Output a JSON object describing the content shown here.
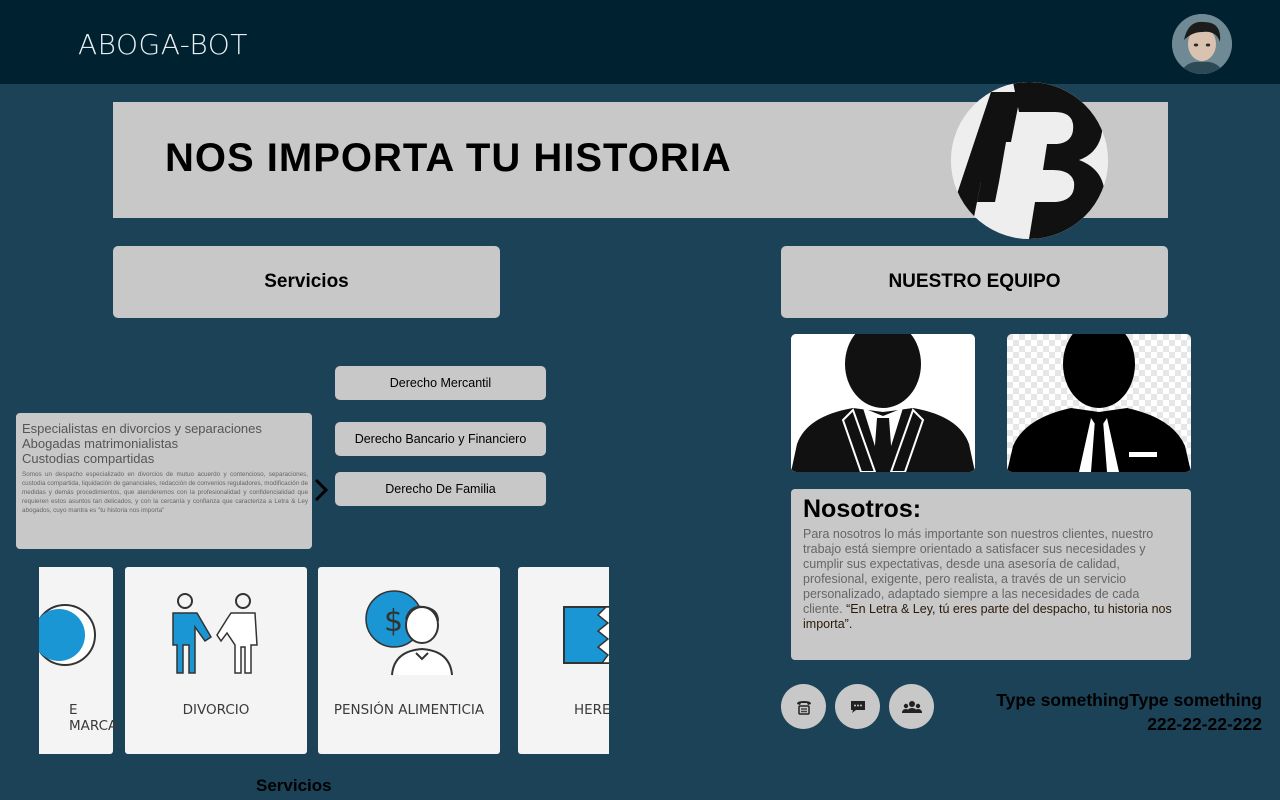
{
  "header": {
    "brand": "ABOGA-BOT",
    "avatar_icon": "user-avatar"
  },
  "hero": {
    "title": "NOS IMPORTA TU HISTORIA",
    "logo_icon": "ab-logo"
  },
  "services": {
    "heading": "Servicios",
    "buttons": [
      "Derecho Mercantil",
      "Derecho Bancario y Financiero",
      "Derecho De Familia"
    ],
    "info": {
      "lines": [
        "Especialistas en divorcios y separaciones",
        "Abogadas matrimonialistas",
        "Custodias compartidas"
      ],
      "paragraph": "Somos un despacho especializado en divorcios de mutuo acuerdo y contencioso, separaciones, custodia compartida, liquidación de gananciales, redacción de convenios reguladores, modificación de medidas y demás procedimientos, que atenderemos con la profesionalidad y confidencialidad que requieren estos asuntos tan delicados, y con la cercanía y confianza que caracteriza a Letra & Ley abogados, cuyo mantra es \"tu historia nos importa\""
    },
    "carousel": [
      {
        "label": "E MARCA",
        "icon": "trademark-icon"
      },
      {
        "label": "DIVORCIO",
        "icon": "divorce-icon"
      },
      {
        "label": "PENSIÓN ALIMENTICIA",
        "icon": "alimony-icon"
      },
      {
        "label": "HERE",
        "icon": "inheritance-icon"
      }
    ],
    "footer_label": "Servicios"
  },
  "team": {
    "heading": "NUESTRO EQUIPO",
    "members": [
      {
        "icon": "person-silhouette-icon"
      },
      {
        "icon": "person-silhouette-icon"
      }
    ]
  },
  "about": {
    "title": "Nosotros:",
    "body": "Para nosotros lo más importante son nuestros clientes, nuestro trabajo está siempre orientado a satisfacer sus necesidades y cumplir sus expectativas, desde una asesoría de calidad, profesional, exigente, pero realista, a través de un servicio personalizado, adaptado siempre a las necesidades de cada cliente. ",
    "quote": "“En Letra & Ley, tú eres parte del despacho, tu historia nos importa”."
  },
  "contact": {
    "line1": "Type somethingType something",
    "line2": "222-22-22-222",
    "icons": [
      "phone-icon",
      "chat-icon",
      "group-icon"
    ]
  },
  "colors": {
    "background": "#1b4257",
    "topbar": "#00212f",
    "panel": "#c8c8c8",
    "accent_blue": "#1a96d4"
  }
}
